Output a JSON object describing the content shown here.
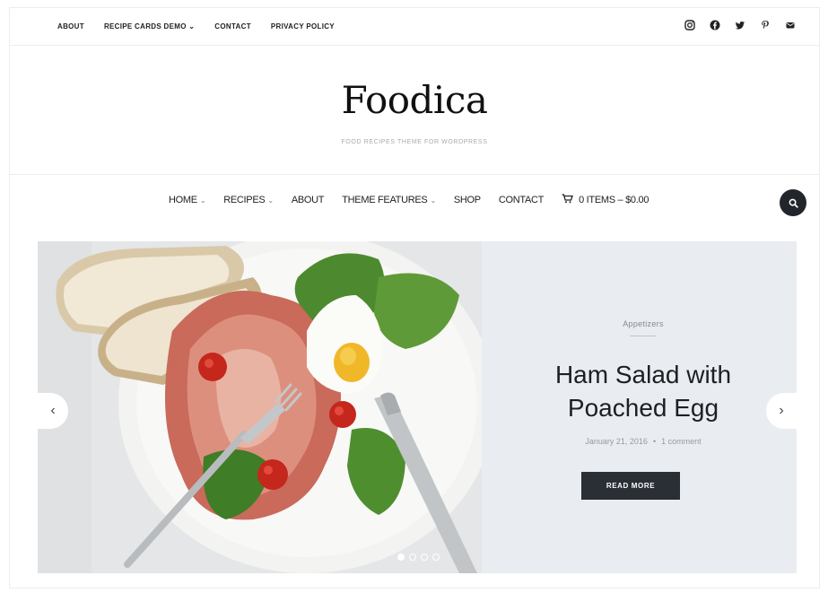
{
  "topbar": {
    "links": [
      "ABOUT",
      "RECIPE CARDS DEMO",
      "CONTACT",
      "PRIVACY POLICY"
    ],
    "dropdown_chevron": "⌄",
    "social_icons": [
      "instagram-icon",
      "facebook-icon",
      "twitter-icon",
      "pinterest-icon",
      "email-icon"
    ]
  },
  "brand": {
    "logo": "Foodica",
    "tagline": "FOOD RECIPES THEME FOR WORDPRESS"
  },
  "nav": {
    "items": [
      {
        "label": "HOME",
        "dropdown": true,
        "active": true
      },
      {
        "label": "RECIPES",
        "dropdown": true
      },
      {
        "label": "ABOUT",
        "dropdown": false
      },
      {
        "label": "THEME FEATURES",
        "dropdown": true
      },
      {
        "label": "SHOP",
        "dropdown": false
      },
      {
        "label": "CONTACT",
        "dropdown": false
      }
    ],
    "cart_label": "0 ITEMS – $0.00",
    "search_icon": "search-icon"
  },
  "slide": {
    "category": "Appetizers",
    "title_line1": "Ham Salad with",
    "title_line2": "Poached Egg",
    "date": "January 21, 2016",
    "comments": "1 comment",
    "button": "READ MORE",
    "prev_arrow": "‹",
    "next_arrow": "›",
    "slide_count": 4,
    "active_slide": 1
  },
  "colors": {
    "accent_dark": "#22252b",
    "slide_bg": "#e9edf1"
  }
}
